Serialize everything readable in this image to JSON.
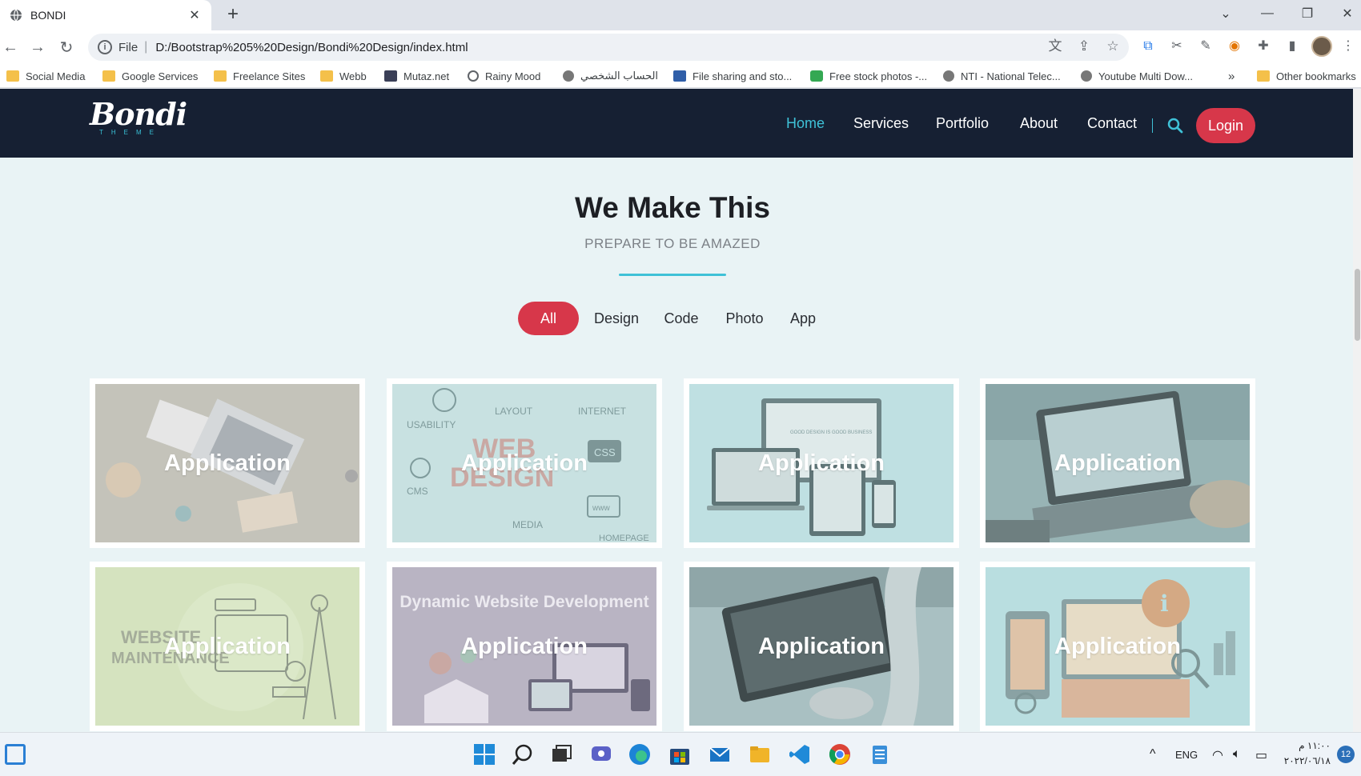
{
  "browser": {
    "tab_title": "BONDI",
    "url_scheme": "File",
    "url": "D:/Bootstrap%205%20Design/Bondi%20Design/index.html"
  },
  "bookmarks": [
    {
      "label": "Social Media",
      "icon": "folder-icon"
    },
    {
      "label": "Google Services",
      "icon": "folder-icon"
    },
    {
      "label": "Freelance Sites",
      "icon": "folder-icon"
    },
    {
      "label": "Webb",
      "icon": "folder-icon"
    },
    {
      "label": "Mutaz.net",
      "icon": "image-icon"
    },
    {
      "label": "Rainy Mood",
      "icon": "rain-icon"
    },
    {
      "label": "الحساب الشخصي",
      "icon": "site-icon"
    },
    {
      "label": "File sharing and sto...",
      "icon": "file-share-icon"
    },
    {
      "label": "Free stock photos -...",
      "icon": "stock-photo-icon"
    },
    {
      "label": "NTI - National Telec...",
      "icon": "satellite-icon"
    },
    {
      "label": "Youtube Multi Dow...",
      "icon": "globe-icon"
    },
    {
      "label": "»",
      "icon": ""
    },
    {
      "label": "Other bookmarks",
      "icon": "folder-icon"
    }
  ],
  "site": {
    "logo_main": "Bondi",
    "logo_sub": "THEME",
    "nav": [
      "Home",
      "Services",
      "Portfolio",
      "About",
      "Contact"
    ],
    "active_nav": "Home",
    "login_label": "Login",
    "accent": "#3fc1d7",
    "button_color": "#d7374a",
    "nav_bg": "#162033"
  },
  "section": {
    "title": "We Make This",
    "subtitle": "PREPARE TO BE AMAZED",
    "filters": [
      "All",
      "Design",
      "Code",
      "Photo",
      "App"
    ],
    "active_filter": "All"
  },
  "portfolio": [
    {
      "label": "Application",
      "image": "desk-laptop-photo"
    },
    {
      "label": "Application",
      "image": "web-design-sketch",
      "image_text": [
        "USABILITY",
        "LAYOUT",
        "INTERNET",
        "WEB",
        "DESIGN",
        "CSS",
        "CMS",
        "MEDIA",
        "HOMEPAGE",
        "www"
      ]
    },
    {
      "label": "Application",
      "image": "responsive-devices",
      "image_text": [
        "GOOD DESIGN IS GOOD BUSINESS"
      ]
    },
    {
      "label": "Application",
      "image": "laptop-photo"
    },
    {
      "label": "Application",
      "image": "website-maintenance",
      "image_text": [
        "WEBSITE",
        "MAINTENANCE"
      ]
    },
    {
      "label": "Application",
      "image": "dynamic-website",
      "image_text": [
        "Dynamic Website Development"
      ]
    },
    {
      "label": "Application",
      "image": "coding-laptop-photo"
    },
    {
      "label": "Application",
      "image": "devices-info-graphic"
    }
  ],
  "taskbar": {
    "language": "ENG",
    "time": "١١:٠٠ م",
    "date": "٢٠٢٢/٠٦/١٨",
    "notification_count": "12"
  }
}
